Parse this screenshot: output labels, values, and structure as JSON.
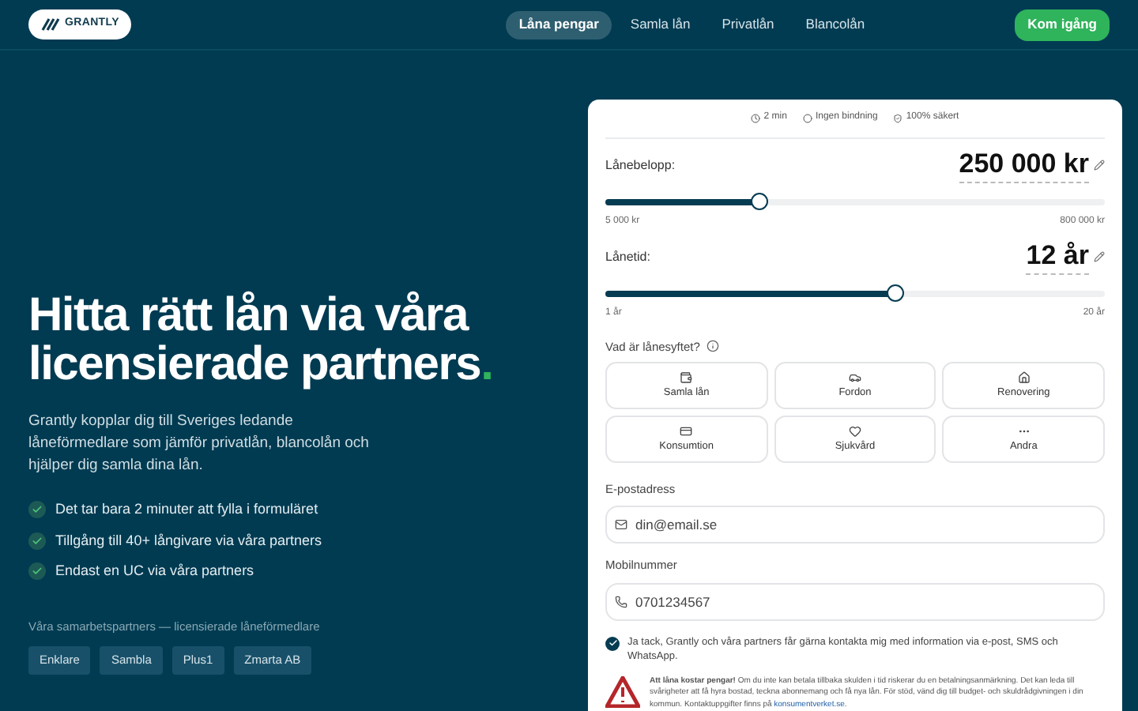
{
  "header": {
    "logo": "GRANTLY",
    "nav": [
      {
        "label": "Låna pengar",
        "selected": true
      },
      {
        "label": "Samla lån",
        "selected": false
      },
      {
        "label": "Privatlån",
        "selected": false
      },
      {
        "label": "Blancolån",
        "selected": false
      }
    ],
    "cta": "Kom igång"
  },
  "hero": {
    "title_line1": "Hitta rätt lån via våra",
    "title_line2": "licensierade partners",
    "title_dot": ".",
    "intro": "Grantly kopplar dig till Sveriges ledande låneförmedlare som jämför privatlån, blancolån och hjälper dig samla dina lån.",
    "benefits": [
      "Det tar bara 2 minuter att fylla i formuläret",
      "Tillgång till 40+ långivare via våra partners",
      "Endast en UC via våra partners"
    ],
    "partners_label": "Våra samarbetspartners — licensierade låneförmedlare",
    "partners": [
      "Enklare",
      "Sambla",
      "Plus1",
      "Zmarta AB"
    ]
  },
  "form": {
    "badges": [
      {
        "kind": "clock",
        "label": "2 min"
      },
      {
        "kind": "circle",
        "label": "Ingen bindning"
      },
      {
        "kind": "shield",
        "label": "100% säkert"
      }
    ],
    "sliders": [
      {
        "label": "Lånebelopp:",
        "value": "250 000 kr",
        "level": 0.31,
        "min": "5 000 kr",
        "max": "800 000 kr"
      },
      {
        "label": "Lånetid:",
        "value": "12 år",
        "level": 0.58,
        "min": "1 år",
        "max": "20 år"
      }
    ],
    "purpose_label": "Vad är lånesyftet?",
    "purposes": [
      {
        "kind": "wallet",
        "label": "Samla lån",
        "selected": false
      },
      {
        "kind": "car",
        "label": "Fordon",
        "selected": false
      },
      {
        "kind": "home",
        "label": "Renovering",
        "selected": false
      },
      {
        "kind": "card",
        "label": "Konsumtion",
        "selected": false
      },
      {
        "kind": "heart",
        "label": "Sjukvård",
        "selected": false
      },
      {
        "kind": "dots",
        "label": "Andra",
        "selected": false
      }
    ],
    "email": {
      "label": "E-postadress",
      "placeholder": "din@email.se"
    },
    "phone": {
      "label": "Mobilnummer",
      "placeholder": "0701234567"
    },
    "consent": {
      "checked": true,
      "text": "Ja tack, Grantly och våra partners får gärna kontakta mig med information via e-post, SMS och WhatsApp."
    },
    "warning": {
      "text": "**Att låna kostar pengar!** Om du inte kan betala tillbaka skulden i tid riskerar du en betalningsanmärkning. Det kan leda till svårigheter att få hyra bostad, teckna abonnemang och få nya lån. För stöd, vänd dig till budget- och skuldrådgivningen i din kommun. Kontaktuppgifter finns på",
      "link": "konsumentverket.se",
      "end": "."
    }
  }
}
